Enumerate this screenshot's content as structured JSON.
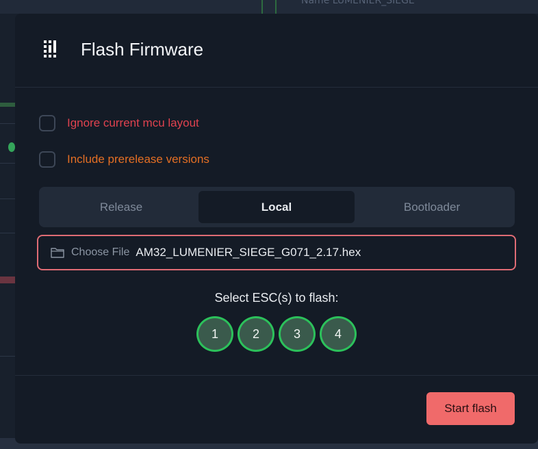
{
  "background": {
    "top_left_text": "",
    "top_right_text": "Name   LUMENIER_SIEGE"
  },
  "modal": {
    "title": "Flash Firmware",
    "header_icon": "firmware-chip-icon",
    "options": [
      {
        "label": "Ignore current mcu layout",
        "checked": false,
        "color": "#e0424f"
      },
      {
        "label": "Include prerelease versions",
        "checked": false,
        "color": "#e56f24"
      }
    ],
    "tabs": [
      {
        "label": "Release",
        "active": false
      },
      {
        "label": "Local",
        "active": true
      },
      {
        "label": "Bootloader",
        "active": false
      }
    ],
    "file": {
      "icon": "folder-icon",
      "choose_label": "Choose File",
      "file_name": "AM32_LUMENIER_SIEGE_G071_2.17.hex"
    },
    "esc_select": {
      "title": "Select ESC(s) to flash:",
      "escs": [
        "1",
        "2",
        "3",
        "4"
      ]
    },
    "start_button": "Start flash"
  },
  "colors": {
    "accent_green": "#2cc15b",
    "danger_red": "#e06c75",
    "start_button": "#f06a6a"
  }
}
